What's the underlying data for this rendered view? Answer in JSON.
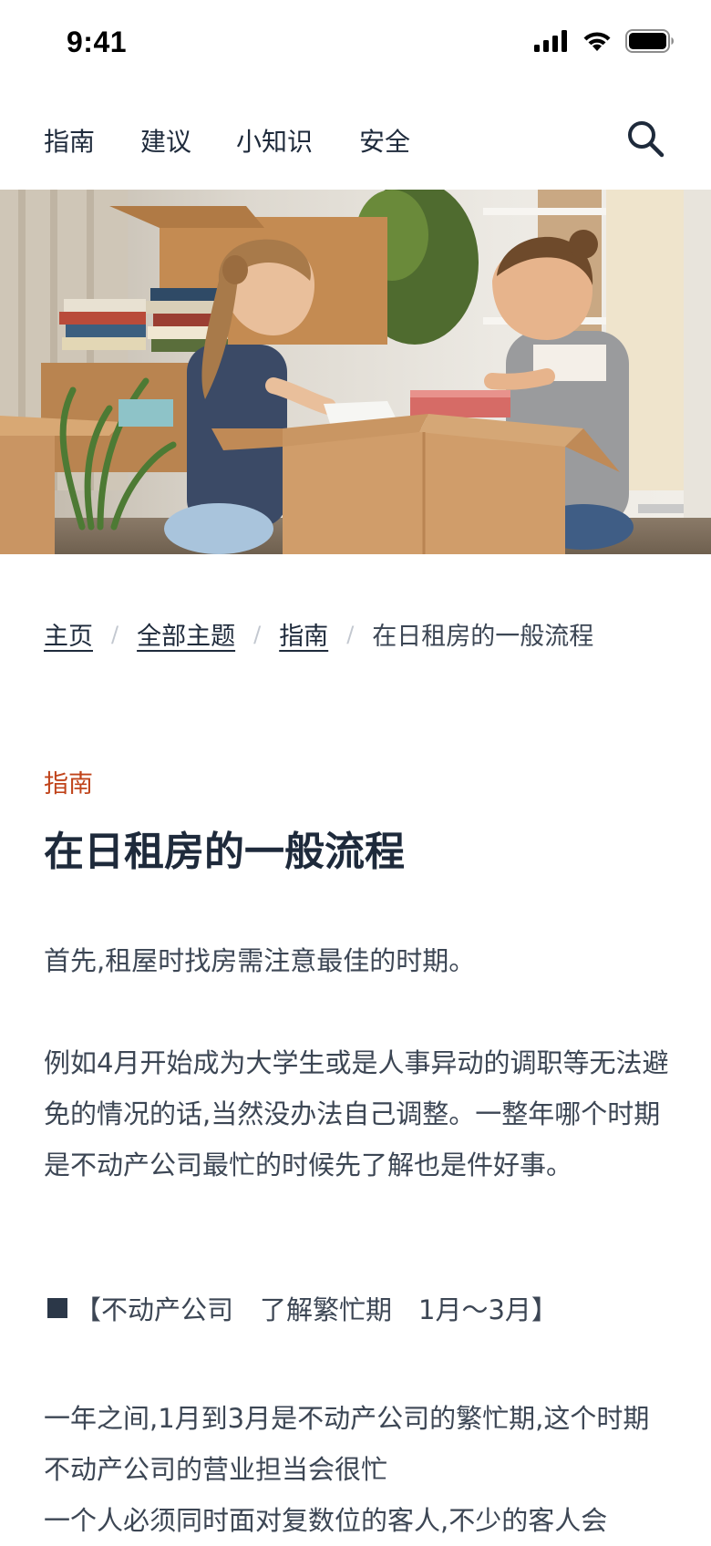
{
  "status": {
    "time": "9:41"
  },
  "nav": {
    "items": [
      {
        "label": "指南"
      },
      {
        "label": "建议"
      },
      {
        "label": "小知识"
      },
      {
        "label": "安全"
      }
    ]
  },
  "hero": {
    "icon": "photo-two-women-unpacking-boxes"
  },
  "breadcrumb": {
    "home": "主页",
    "all_topics": "全部主题",
    "guide": "指南",
    "current": "在日租房的一般流程"
  },
  "article": {
    "category": "指南",
    "title": "在日租房的一般流程",
    "p1": "首先,租屋时找房需注意最佳的时期。",
    "p2": "例如4月开始成为大学生或是人事异动的调职等无法避免的情况的话,当然没办法自己调整。一整年哪个时期是不动产公司最忙的时候先了解也是件好事。",
    "heading": "【不动产公司　了解繁忙期　1月～3月】",
    "p3": "一年之间,1月到3月是不动产公司的繁忙期,这个时期不动产公司的营业担当会很忙\n一个人必须同时面对复数位的客人,不少的客人会"
  },
  "colors": {
    "accent": "#c0431a",
    "text": "#1e2a3b",
    "body_text": "#3c4654"
  }
}
